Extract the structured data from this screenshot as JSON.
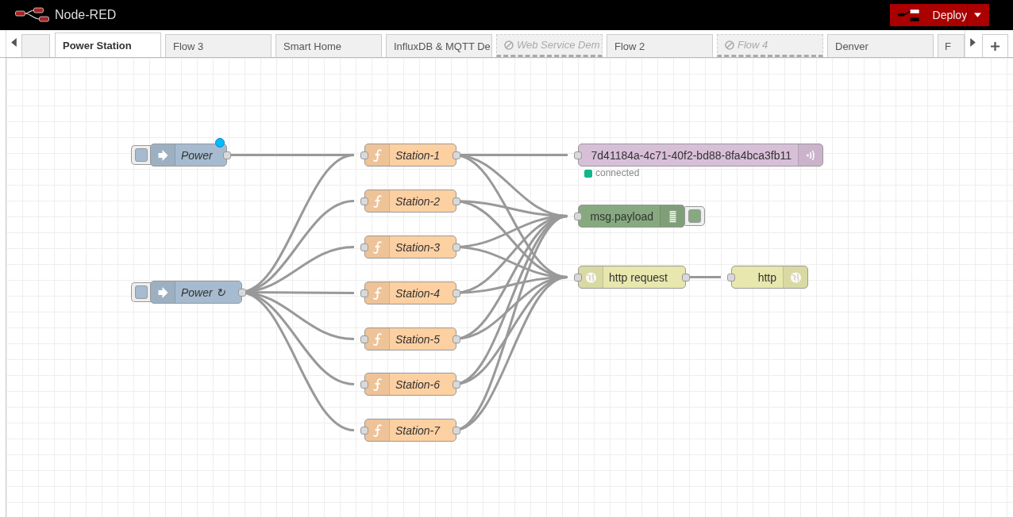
{
  "header": {
    "title": "Node-RED",
    "deploy_label": "Deploy"
  },
  "tabs": [
    {
      "label": "Power Station",
      "selected": true,
      "disabled": false
    },
    {
      "label": "Flow 3",
      "selected": false,
      "disabled": false
    },
    {
      "label": "Smart Home",
      "selected": false,
      "disabled": false
    },
    {
      "label": "InfluxDB & MQTT De",
      "selected": false,
      "disabled": false
    },
    {
      "label": "Web Service Dem",
      "selected": false,
      "disabled": true
    },
    {
      "label": "Flow 2",
      "selected": false,
      "disabled": false
    },
    {
      "label": "Flow 4",
      "selected": false,
      "disabled": true
    },
    {
      "label": "Denver",
      "selected": false,
      "disabled": false
    },
    {
      "label": "F",
      "selected": false,
      "disabled": false
    }
  ],
  "nodes": [
    {
      "kind": "inject",
      "label": "Power",
      "changed": true
    },
    {
      "kind": "inject",
      "label": "Power ↻",
      "changed": false
    },
    {
      "kind": "function",
      "label": "Station-1",
      "changed": false
    },
    {
      "kind": "function",
      "label": "Station-2",
      "changed": false
    },
    {
      "kind": "function",
      "label": "Station-3",
      "changed": false
    },
    {
      "kind": "function",
      "label": "Station-4",
      "changed": false
    },
    {
      "kind": "function",
      "label": "Station-5",
      "changed": false
    },
    {
      "kind": "function",
      "label": "Station-6",
      "changed": false
    },
    {
      "kind": "function",
      "label": "Station-7",
      "changed": false
    },
    {
      "kind": "mqtt",
      "label": "7d41184a-4c71-40f2-bd88-8fa4bca3fb11",
      "changed": false,
      "status": {
        "text": "connected",
        "color": "#0fb68c"
      }
    },
    {
      "kind": "debug",
      "label": "msg.payload",
      "changed": false
    },
    {
      "kind": "http_request",
      "label": "http request",
      "changed": false
    },
    {
      "kind": "http_response",
      "label": "http",
      "changed": false
    }
  ]
}
